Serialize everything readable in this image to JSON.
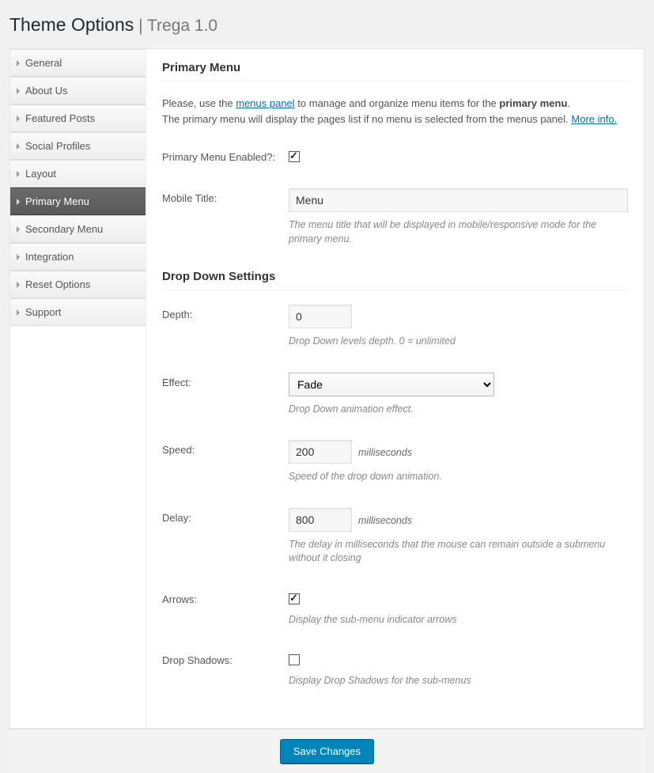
{
  "header": {
    "title": "Theme Options",
    "separator": " | ",
    "subtitle": "Trega 1.0"
  },
  "sidebar": {
    "items": [
      {
        "label": "General",
        "active": false
      },
      {
        "label": "About Us",
        "active": false
      },
      {
        "label": "Featured Posts",
        "active": false
      },
      {
        "label": "Social Profiles",
        "active": false
      },
      {
        "label": "Layout",
        "active": false
      },
      {
        "label": "Primary Menu",
        "active": true
      },
      {
        "label": "Secondary Menu",
        "active": false
      },
      {
        "label": "Integration",
        "active": false
      },
      {
        "label": "Reset Options",
        "active": false
      },
      {
        "label": "Support",
        "active": false
      }
    ]
  },
  "section1": {
    "title": "Primary Menu",
    "intro_before": "Please, use the ",
    "intro_link": "menus panel",
    "intro_after": " to manage and organize menu items for the ",
    "intro_bold": "primary menu",
    "intro_line2": "The primary menu will display the pages list if no menu is selected from the menus panel. ",
    "intro_more": "More info."
  },
  "fields": {
    "enabled_label": "Primary Menu Enabled?:",
    "enabled_value": true,
    "mobile_title_label": "Mobile Title:",
    "mobile_title_value": "Menu",
    "mobile_title_desc": "The menu title that will be displayed in mobile/responsive mode for the primary menu."
  },
  "section2": {
    "title": "Drop Down Settings"
  },
  "dd": {
    "depth_label": "Depth:",
    "depth_value": "0",
    "depth_desc": "Drop Down levels depth. 0 = unlimited",
    "effect_label": "Effect:",
    "effect_value": "Fade",
    "effect_desc": "Drop Down animation effect.",
    "speed_label": "Speed:",
    "speed_value": "200",
    "speed_unit": "milliseconds",
    "speed_desc": "Speed of the drop down animation.",
    "delay_label": "Delay:",
    "delay_value": "800",
    "delay_unit": "milliseconds",
    "delay_desc": "The delay in milliseconds that the mouse can remain outside a submenu without it closing",
    "arrows_label": "Arrows:",
    "arrows_value": true,
    "arrows_desc": "Display the sub-menu indicator arrows",
    "shadows_label": "Drop Shadows:",
    "shadows_value": false,
    "shadows_desc": "Display Drop Shadows for the sub-menus"
  },
  "footer": {
    "save_label": "Save Changes"
  }
}
